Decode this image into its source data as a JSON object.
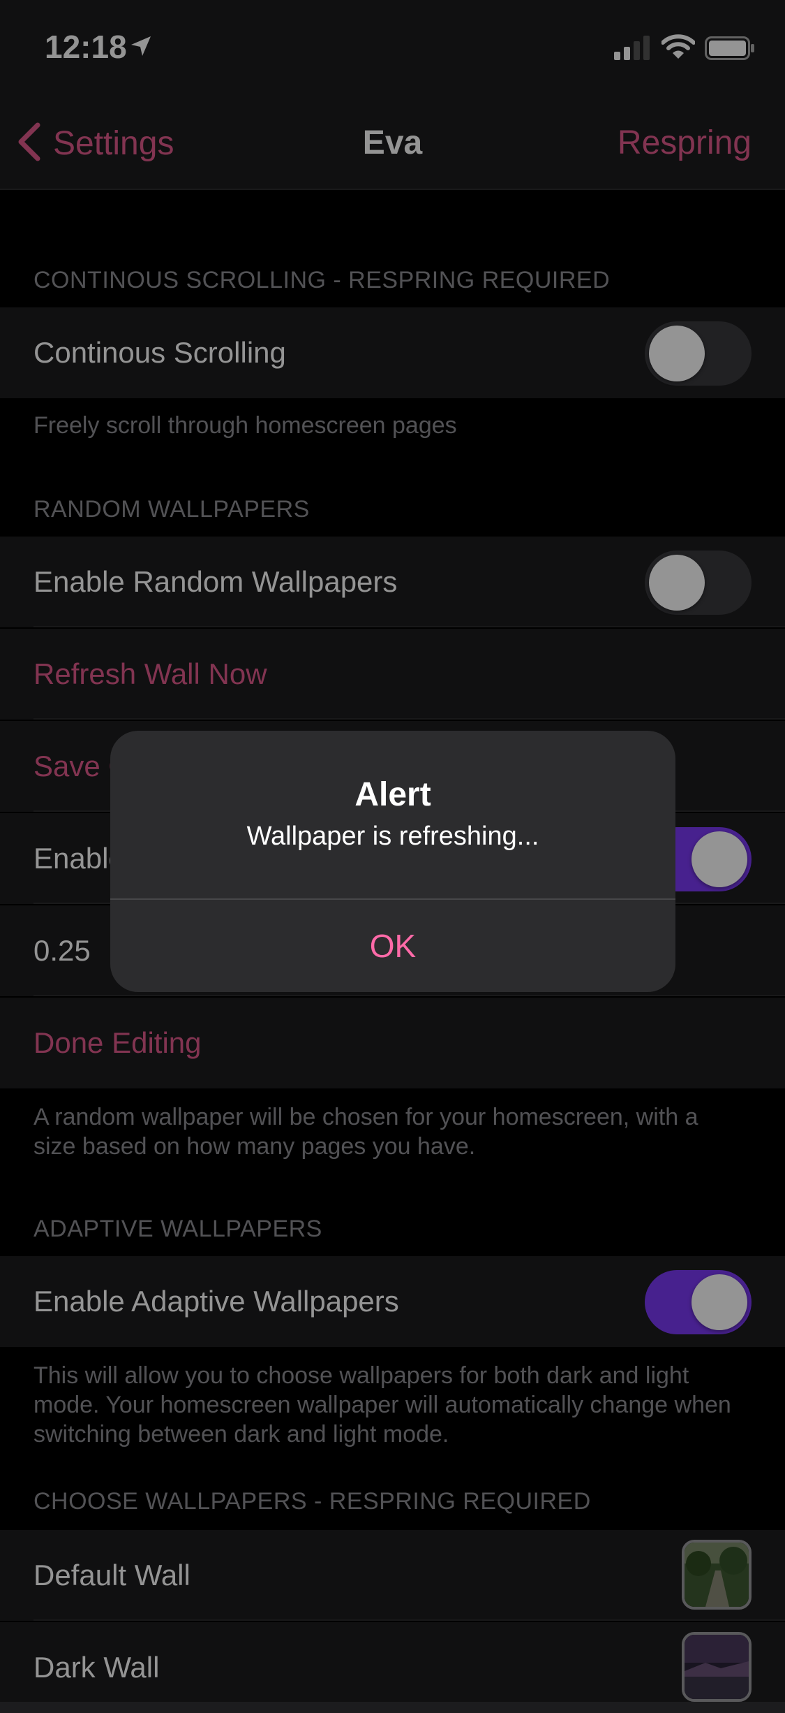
{
  "status": {
    "time": "12:18"
  },
  "nav": {
    "back_label": "Settings",
    "title": "Eva",
    "action_label": "Respring"
  },
  "sections": {
    "continuous": {
      "header": "CONTINOUS SCROLLING - RESPRING REQUIRED",
      "toggle_label": "Continous Scrolling",
      "toggle_on": false,
      "footer": "Freely scroll through homescreen pages"
    },
    "random": {
      "header": "RANDOM WALLPAPERS",
      "enable_label": "Enable Random Wallpapers",
      "enable_on": false,
      "refresh_label": "Refresh Wall Now",
      "save_label": "Save C",
      "enable2_label": "Enable",
      "enable2_on": true,
      "value": "0.25",
      "done_label": "Done Editing",
      "footer": "A random wallpaper will be chosen for your homescreen, with a size based on how many pages you have."
    },
    "adaptive": {
      "header": "ADAPTIVE WALLPAPERS",
      "enable_label": "Enable Adaptive Wallpapers",
      "enable_on": true,
      "footer": "This will allow you to choose wallpapers for both dark and light mode. Your homescreen wallpaper will automatically change when switching between dark and light mode."
    },
    "choose": {
      "header": "CHOOSE WALLPAPERS - RESPRING REQUIRED",
      "items": [
        {
          "label": "Default Wall"
        },
        {
          "label": "Dark Wall"
        }
      ]
    }
  },
  "alert": {
    "title": "Alert",
    "message": "Wallpaper is refreshing...",
    "button": "OK"
  },
  "colors": {
    "accent": "#e05a8c",
    "switch_on": "#7b39f4",
    "background": "#000000",
    "cell": "#1c1c1e"
  }
}
